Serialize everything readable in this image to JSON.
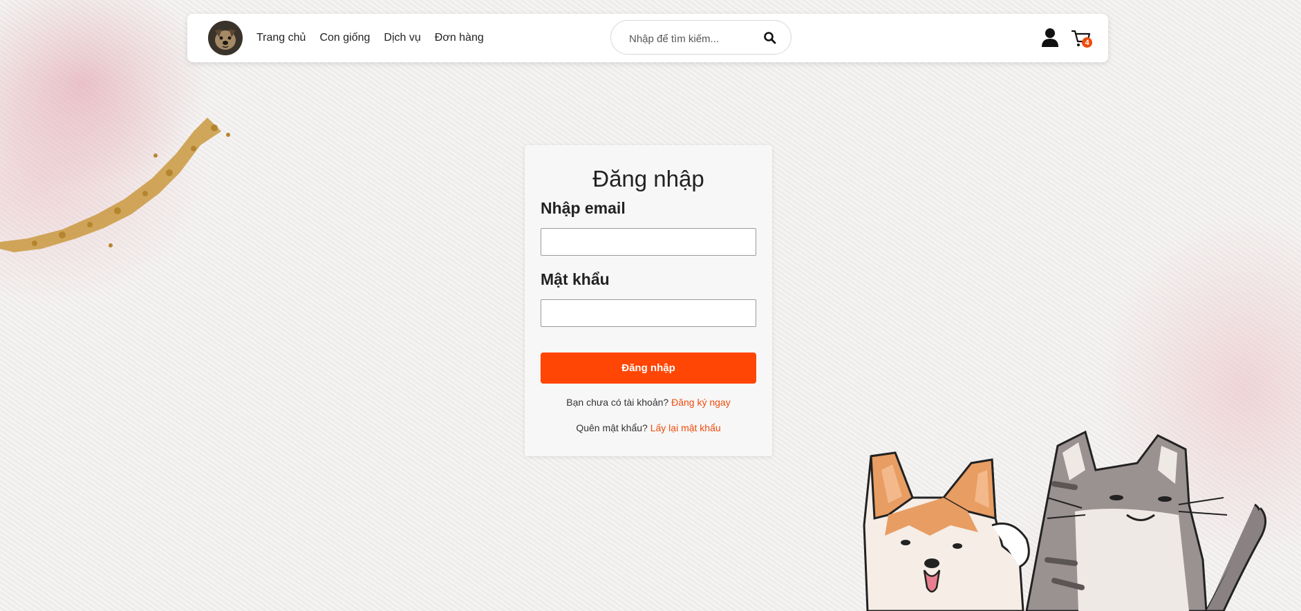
{
  "header": {
    "logo_alt": "dog-avatar",
    "nav": [
      "Trang chủ",
      "Con giống",
      "Dịch vụ",
      "Đơn hàng"
    ],
    "search": {
      "placeholder": "Nhập để tìm kiếm...",
      "value": ""
    },
    "cart_count": "4"
  },
  "login": {
    "title": "Đăng nhập",
    "email_label": "Nhập email",
    "email_value": "",
    "password_label": "Mật khẩu",
    "password_value": "",
    "submit_label": "Đăng nhập",
    "register_prompt": "Bạn chưa có tài khoản?",
    "register_link": "Đăng ký ngay",
    "forgot_prompt": "Quên mật khẩu?",
    "forgot_link": "Lấy lại mật khẩu"
  },
  "colors": {
    "accent": "#ff4605",
    "badge": "#f04a0b",
    "background": "#f2f0ef"
  },
  "icons": [
    "dog-avatar",
    "search-icon",
    "user-icon",
    "cart-icon",
    "corgi-illustration",
    "cat-illustration"
  ]
}
